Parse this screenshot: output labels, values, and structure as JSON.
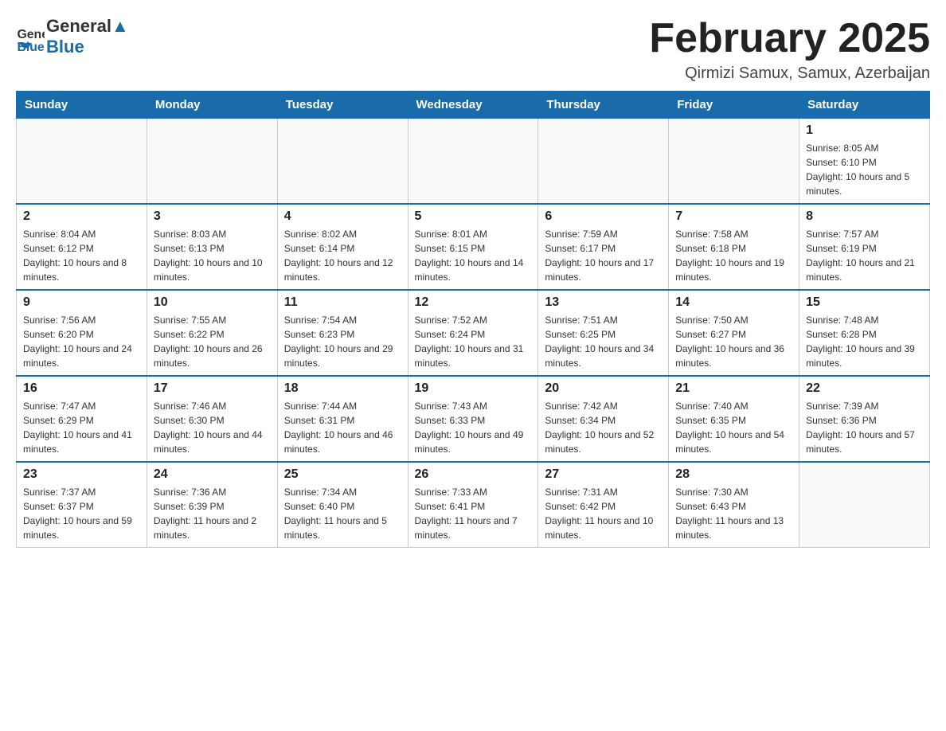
{
  "header": {
    "logo_text_general": "General",
    "logo_text_blue": "Blue",
    "month_title": "February 2025",
    "location": "Qirmizi Samux, Samux, Azerbaijan"
  },
  "weekdays": [
    "Sunday",
    "Monday",
    "Tuesday",
    "Wednesday",
    "Thursday",
    "Friday",
    "Saturday"
  ],
  "weeks": [
    [
      {
        "day": "",
        "info": ""
      },
      {
        "day": "",
        "info": ""
      },
      {
        "day": "",
        "info": ""
      },
      {
        "day": "",
        "info": ""
      },
      {
        "day": "",
        "info": ""
      },
      {
        "day": "",
        "info": ""
      },
      {
        "day": "1",
        "info": "Sunrise: 8:05 AM\nSunset: 6:10 PM\nDaylight: 10 hours and 5 minutes."
      }
    ],
    [
      {
        "day": "2",
        "info": "Sunrise: 8:04 AM\nSunset: 6:12 PM\nDaylight: 10 hours and 8 minutes."
      },
      {
        "day": "3",
        "info": "Sunrise: 8:03 AM\nSunset: 6:13 PM\nDaylight: 10 hours and 10 minutes."
      },
      {
        "day": "4",
        "info": "Sunrise: 8:02 AM\nSunset: 6:14 PM\nDaylight: 10 hours and 12 minutes."
      },
      {
        "day": "5",
        "info": "Sunrise: 8:01 AM\nSunset: 6:15 PM\nDaylight: 10 hours and 14 minutes."
      },
      {
        "day": "6",
        "info": "Sunrise: 7:59 AM\nSunset: 6:17 PM\nDaylight: 10 hours and 17 minutes."
      },
      {
        "day": "7",
        "info": "Sunrise: 7:58 AM\nSunset: 6:18 PM\nDaylight: 10 hours and 19 minutes."
      },
      {
        "day": "8",
        "info": "Sunrise: 7:57 AM\nSunset: 6:19 PM\nDaylight: 10 hours and 21 minutes."
      }
    ],
    [
      {
        "day": "9",
        "info": "Sunrise: 7:56 AM\nSunset: 6:20 PM\nDaylight: 10 hours and 24 minutes."
      },
      {
        "day": "10",
        "info": "Sunrise: 7:55 AM\nSunset: 6:22 PM\nDaylight: 10 hours and 26 minutes."
      },
      {
        "day": "11",
        "info": "Sunrise: 7:54 AM\nSunset: 6:23 PM\nDaylight: 10 hours and 29 minutes."
      },
      {
        "day": "12",
        "info": "Sunrise: 7:52 AM\nSunset: 6:24 PM\nDaylight: 10 hours and 31 minutes."
      },
      {
        "day": "13",
        "info": "Sunrise: 7:51 AM\nSunset: 6:25 PM\nDaylight: 10 hours and 34 minutes."
      },
      {
        "day": "14",
        "info": "Sunrise: 7:50 AM\nSunset: 6:27 PM\nDaylight: 10 hours and 36 minutes."
      },
      {
        "day": "15",
        "info": "Sunrise: 7:48 AM\nSunset: 6:28 PM\nDaylight: 10 hours and 39 minutes."
      }
    ],
    [
      {
        "day": "16",
        "info": "Sunrise: 7:47 AM\nSunset: 6:29 PM\nDaylight: 10 hours and 41 minutes."
      },
      {
        "day": "17",
        "info": "Sunrise: 7:46 AM\nSunset: 6:30 PM\nDaylight: 10 hours and 44 minutes."
      },
      {
        "day": "18",
        "info": "Sunrise: 7:44 AM\nSunset: 6:31 PM\nDaylight: 10 hours and 46 minutes."
      },
      {
        "day": "19",
        "info": "Sunrise: 7:43 AM\nSunset: 6:33 PM\nDaylight: 10 hours and 49 minutes."
      },
      {
        "day": "20",
        "info": "Sunrise: 7:42 AM\nSunset: 6:34 PM\nDaylight: 10 hours and 52 minutes."
      },
      {
        "day": "21",
        "info": "Sunrise: 7:40 AM\nSunset: 6:35 PM\nDaylight: 10 hours and 54 minutes."
      },
      {
        "day": "22",
        "info": "Sunrise: 7:39 AM\nSunset: 6:36 PM\nDaylight: 10 hours and 57 minutes."
      }
    ],
    [
      {
        "day": "23",
        "info": "Sunrise: 7:37 AM\nSunset: 6:37 PM\nDaylight: 10 hours and 59 minutes."
      },
      {
        "day": "24",
        "info": "Sunrise: 7:36 AM\nSunset: 6:39 PM\nDaylight: 11 hours and 2 minutes."
      },
      {
        "day": "25",
        "info": "Sunrise: 7:34 AM\nSunset: 6:40 PM\nDaylight: 11 hours and 5 minutes."
      },
      {
        "day": "26",
        "info": "Sunrise: 7:33 AM\nSunset: 6:41 PM\nDaylight: 11 hours and 7 minutes."
      },
      {
        "day": "27",
        "info": "Sunrise: 7:31 AM\nSunset: 6:42 PM\nDaylight: 11 hours and 10 minutes."
      },
      {
        "day": "28",
        "info": "Sunrise: 7:30 AM\nSunset: 6:43 PM\nDaylight: 11 hours and 13 minutes."
      },
      {
        "day": "",
        "info": ""
      }
    ]
  ]
}
